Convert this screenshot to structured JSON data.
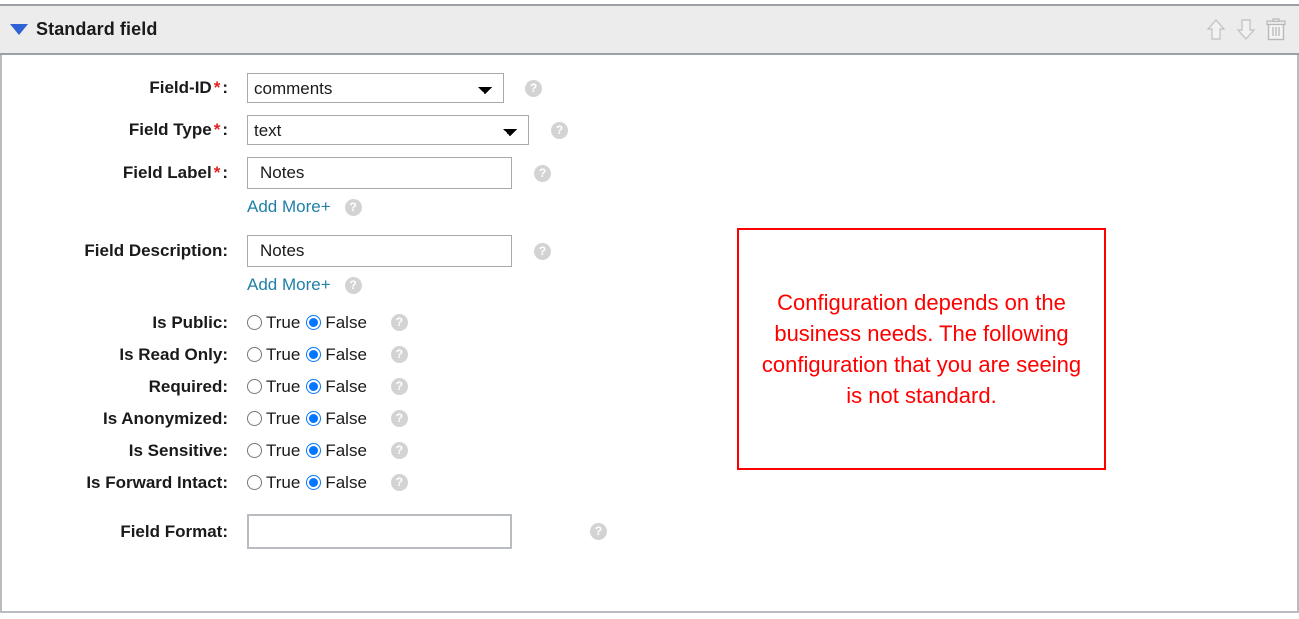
{
  "panel": {
    "title": "Standard field",
    "collapse_icon": "triangle-down-icon",
    "accent_color": "#2f62d4",
    "tools": [
      {
        "name": "move-up-icon",
        "label": "Move up"
      },
      {
        "name": "move-down-icon",
        "label": "Move down"
      },
      {
        "name": "delete-icon",
        "label": "Delete"
      }
    ]
  },
  "help_glyph": "?",
  "form": {
    "field_id": {
      "label": "Field-ID",
      "required_mark": "*",
      "colon": ":",
      "value": "comments",
      "options": [
        "comments"
      ]
    },
    "field_type": {
      "label": "Field Type",
      "required_mark": "*",
      "colon": ":",
      "value": "text",
      "options": [
        "text"
      ]
    },
    "field_label": {
      "label": "Field Label",
      "required_mark": "*",
      "colon": ":",
      "value": "Notes",
      "placeholder": "",
      "add_more": "Add More+"
    },
    "field_description": {
      "label": "Field Description:",
      "value": "Notes",
      "placeholder": "",
      "add_more": "Add More+"
    },
    "field_format": {
      "label": "Field Format:",
      "value": "",
      "placeholder": ""
    },
    "true_label": "True",
    "false_label": "False",
    "booleans": [
      {
        "key": "is_public",
        "label": "Is Public:",
        "selected": "False"
      },
      {
        "key": "is_read_only",
        "label": "Is Read Only:",
        "selected": "False"
      },
      {
        "key": "required",
        "label": "Required:",
        "selected": "False"
      },
      {
        "key": "is_anonymized",
        "label": "Is Anonymized:",
        "selected": "False"
      },
      {
        "key": "is_sensitive",
        "label": "Is Sensitive:",
        "selected": "False"
      },
      {
        "key": "is_forward_intact",
        "label": "Is Forward Intact:",
        "selected": "False"
      }
    ]
  },
  "note": {
    "text": "Configuration depends on the business needs. The following configuration that you are seeing is not standard.",
    "border_color": "#ff0000",
    "text_color": "#ff0000"
  }
}
